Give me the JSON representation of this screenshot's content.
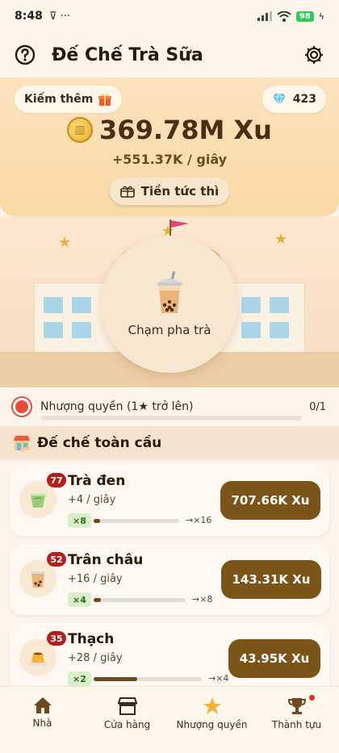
{
  "status": {
    "time": "8:48",
    "extra": "⊽ ···",
    "battery": "98"
  },
  "header": {
    "title": "Đế Chế Trà Sữa"
  },
  "hero": {
    "earn_more": "Kiếm thêm",
    "gems": "423",
    "coins": "369.78M Xu",
    "rate": "+551.37K / giây",
    "instant_cash": "Tiền tức thì"
  },
  "scene": {
    "tap_label": "Chạm pha trà"
  },
  "franchise": {
    "label": "Nhượng quyền (1★ trở lên)",
    "progress_text": "0/1",
    "progress": 0
  },
  "section": {
    "title": "Đế chế toàn cầu"
  },
  "products": [
    {
      "name": "Trà đen",
      "level": "77",
      "rate": "+4 / giây",
      "multiplier": "×8",
      "next": "→×16",
      "progress": 0.08,
      "price": "707.66K Xu"
    },
    {
      "name": "Trân châu",
      "level": "52",
      "rate": "+16 / giây",
      "multiplier": "×4",
      "next": "→×8",
      "progress": 0.08,
      "price": "143.31K Xu"
    },
    {
      "name": "Thạch",
      "level": "35",
      "rate": "+28 / giây",
      "multiplier": "×2",
      "next": "→×4",
      "progress": 0.4,
      "price": "43.95K Xu"
    }
  ],
  "nav": [
    {
      "label": "Nhà"
    },
    {
      "label": "Cửa hàng"
    },
    {
      "label": "Nhượng quyền"
    },
    {
      "label": "Thành tựu"
    }
  ],
  "colors": {
    "accent": "#7A5418",
    "hero": "#FCE3BD",
    "badge": "#B31E1E"
  }
}
